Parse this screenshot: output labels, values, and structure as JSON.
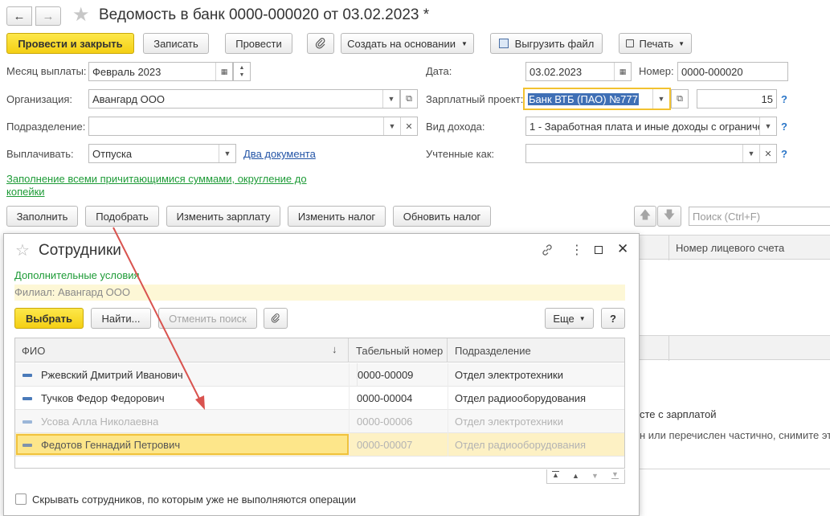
{
  "doc": {
    "title": "Ведомость в банк 0000-000020 от 03.02.2023 *",
    "buttons": {
      "post_close": "Провести и закрыть",
      "save": "Записать",
      "post": "Провести",
      "create_based": "Создать на основании",
      "export": "Выгрузить файл",
      "print": "Печать"
    },
    "fields": {
      "month_label": "Месяц выплаты:",
      "month_value": "Февраль 2023",
      "date_label": "Дата:",
      "date_value": "03.02.2023",
      "number_label": "Номер:",
      "number_value": "0000-000020",
      "org_label": "Организация:",
      "org_value": "Авангард ООО",
      "salary_project_label": "Зарплатный проект:",
      "salary_project_value": "Банк ВТБ (ПАО) №777",
      "salary_project_code": "15",
      "dept_label": "Подразделение:",
      "dept_value": "",
      "income_label": "Вид дохода:",
      "income_value": "1 - Заработная плата и иные доходы с ограниче",
      "pay_label": "Выплачивать:",
      "pay_value": "Отпуска",
      "docs_link": "Два документа",
      "counted_label": "Учтенные как:",
      "counted_value": ""
    },
    "fill_link_line1": "Заполнение всеми причитающимися суммами, округление до",
    "fill_link_line2": "копейки",
    "toolbar": {
      "fill": "Заполнить",
      "pick": "Подобрать",
      "change_salary": "Изменить зарплату",
      "change_tax": "Изменить налог",
      "update_tax": "Обновить налог",
      "search_placeholder": "Поиск (Ctrl+F)"
    },
    "table_header_account": "Номер лицевого счета",
    "bg_text_1": "сте с зарплатой",
    "bg_text_2": "н или перечислен частично, снимите эт"
  },
  "modal": {
    "title": "Сотрудники",
    "additional_conditions": "Дополнительные условия",
    "filter_text": "Филиал: Авангард ООО",
    "buttons": {
      "select": "Выбрать",
      "find": "Найти...",
      "cancel_search": "Отменить поиск",
      "more": "Еще",
      "help": "?"
    },
    "columns": {
      "name": "ФИО",
      "tab_number": "Табельный номер",
      "dept": "Подразделение"
    },
    "rows": [
      {
        "name": "Ржевский Дмитрий Иванович",
        "tab": "0000-00009",
        "dept": "Отдел электротехники"
      },
      {
        "name": "Тучков Федор Федорович",
        "tab": "0000-00004",
        "dept": "Отдел радиооборудования"
      },
      {
        "name": "Усова Алла Николаевна",
        "tab": "0000-00006",
        "dept": "Отдел электротехники"
      },
      {
        "name": "Федотов Геннадий Петрович",
        "tab": "0000-00007",
        "dept": "Отдел радиооборудования"
      }
    ],
    "hide_checkbox_label": "Скрывать сотрудников, по которым уже не выполняются операции"
  },
  "colors": {
    "accent_yellow": "#f4cf14",
    "link_green": "#1e9b37",
    "link_blue": "#2354a6",
    "selected_row": "#fde68a",
    "arrow_red": "#d9534f"
  }
}
